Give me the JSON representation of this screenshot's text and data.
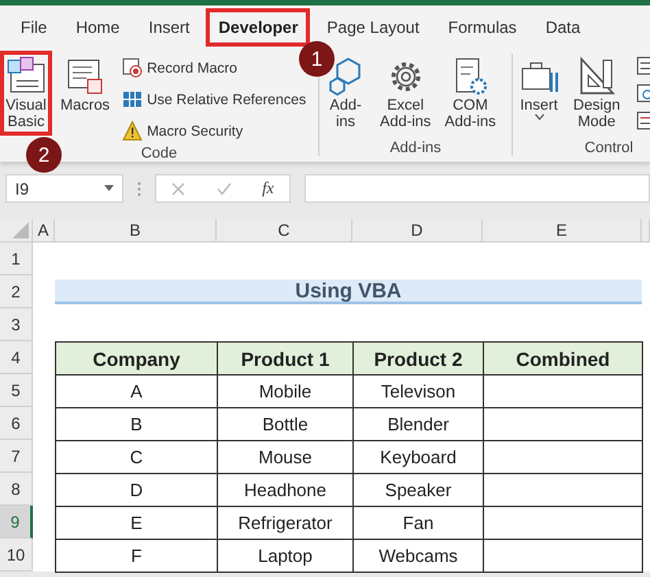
{
  "tabs": [
    {
      "label": "File",
      "selected": false,
      "highlighted": false
    },
    {
      "label": "Home",
      "selected": false,
      "highlighted": false
    },
    {
      "label": "Insert",
      "selected": false,
      "highlighted": false
    },
    {
      "label": "Developer",
      "selected": true,
      "highlighted": true
    },
    {
      "label": "Page Layout",
      "selected": false,
      "highlighted": false
    },
    {
      "label": "Formulas",
      "selected": false,
      "highlighted": false
    },
    {
      "label": "Data",
      "selected": false,
      "highlighted": false
    }
  ],
  "ribbon": {
    "groups": [
      {
        "label": "Code",
        "buttons": [
          {
            "kind": "large",
            "lines": [
              "Visual",
              "Basic"
            ],
            "highlighted": true
          },
          {
            "kind": "large",
            "lines": [
              "Macros"
            ],
            "highlighted": false
          },
          {
            "kind": "small",
            "lines": [
              "Record Macro"
            ],
            "highlighted": false
          },
          {
            "kind": "small",
            "lines": [
              "Use Relative References"
            ],
            "highlighted": false
          },
          {
            "kind": "small",
            "lines": [
              "Macro Security"
            ],
            "highlighted": false
          }
        ]
      },
      {
        "label": "Add-ins",
        "buttons": [
          {
            "kind": "large",
            "lines": [
              "Add-",
              "ins"
            ],
            "highlighted": false
          },
          {
            "kind": "large",
            "lines": [
              "Excel",
              "Add-ins"
            ],
            "highlighted": false
          },
          {
            "kind": "large",
            "lines": [
              "COM",
              "Add-ins"
            ],
            "highlighted": false
          }
        ]
      },
      {
        "label": "Control",
        "buttons": [
          {
            "kind": "dropdown",
            "lines": [
              "Insert"
            ],
            "highlighted": false
          },
          {
            "kind": "large",
            "lines": [
              "Design",
              "Mode"
            ],
            "highlighted": false
          }
        ]
      }
    ]
  },
  "callouts": [
    {
      "number": "1"
    },
    {
      "number": "2"
    }
  ],
  "formula_bar": {
    "name_box": "I9",
    "function_label": "fx"
  },
  "sheet": {
    "columns": [
      "A",
      "B",
      "C",
      "D",
      "E"
    ],
    "rows": [
      {
        "number": "1",
        "selected": false
      },
      {
        "number": "2",
        "selected": false
      },
      {
        "number": "3",
        "selected": false
      },
      {
        "number": "4",
        "selected": false
      },
      {
        "number": "5",
        "selected": false
      },
      {
        "number": "6",
        "selected": false
      },
      {
        "number": "7",
        "selected": false
      },
      {
        "number": "8",
        "selected": false
      },
      {
        "number": "9",
        "selected": true
      },
      {
        "number": "10",
        "selected": false
      }
    ],
    "title": "Using VBA",
    "table": {
      "columns": [
        "Company",
        "Product 1",
        "Product 2",
        "Combined"
      ],
      "rows": [
        [
          "A",
          "Mobile",
          "Televison"
        ],
        [
          "B",
          "Bottle",
          "Blender"
        ],
        [
          "C",
          "Mouse",
          "Keyboard"
        ],
        [
          "D",
          "Headhone",
          "Speaker"
        ],
        [
          "E",
          "Refrigerator",
          "Fan"
        ],
        [
          "F",
          "Laptop",
          "Webcams"
        ]
      ]
    }
  }
}
